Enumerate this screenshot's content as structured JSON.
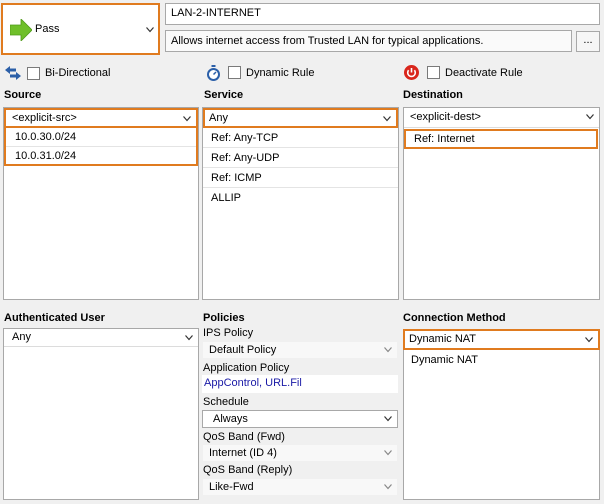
{
  "action": {
    "label": "Pass",
    "accent_color": "#6fbf2a"
  },
  "rule": {
    "name": "LAN-2-INTERNET",
    "description": "Allows internet access from Trusted LAN for typical applications.",
    "more_button": "..."
  },
  "options": {
    "bidirectional": "Bi-Directional",
    "dynamic_rule": "Dynamic Rule",
    "deactivate_rule": "Deactivate Rule"
  },
  "source": {
    "title": "Source",
    "selected": "<explicit-src>",
    "items": [
      "10.0.30.0/24",
      "10.0.31.0/24"
    ]
  },
  "service": {
    "title": "Service",
    "selected": "Any",
    "items": [
      "Ref: Any-TCP",
      "Ref: Any-UDP",
      "Ref: ICMP",
      "ALLIP"
    ]
  },
  "destination": {
    "title": "Destination",
    "selected": "<explicit-dest>",
    "items": [
      "Ref: Internet"
    ]
  },
  "auth_user": {
    "title": "Authenticated User",
    "selected": "Any"
  },
  "policies": {
    "title": "Policies",
    "ips_label": "IPS Policy",
    "ips_value": "Default Policy",
    "app_label": "Application Policy",
    "app_value": "AppControl, URL.Fil",
    "schedule_label": "Schedule",
    "schedule_value": "Always",
    "qos_fwd_label": "QoS Band (Fwd)",
    "qos_fwd_value": "Internet (ID 4)",
    "qos_reply_label": "QoS Band (Reply)",
    "qos_reply_value": "Like-Fwd"
  },
  "connection": {
    "title": "Connection Method",
    "selected": "Dynamic NAT",
    "items": [
      "Dynamic NAT"
    ]
  },
  "colors": {
    "highlight": "#e07b1f",
    "link": "#1a1aa6",
    "deactivate_red": "#d9261c",
    "arrow_blue": "#2b5fa8"
  }
}
